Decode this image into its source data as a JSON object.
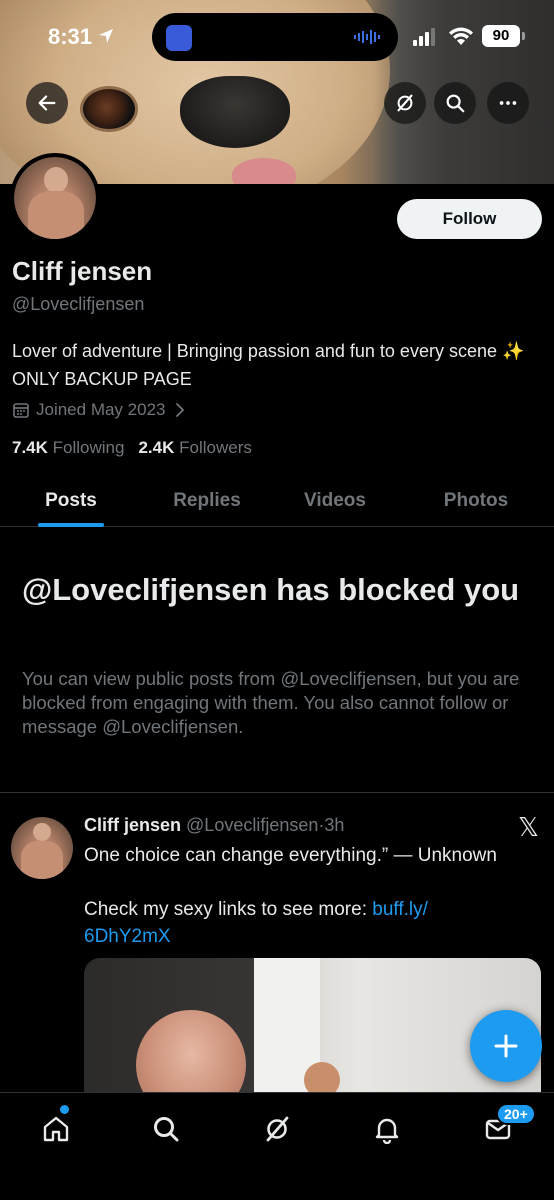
{
  "status_bar": {
    "time": "8:31",
    "battery": "90"
  },
  "header": {
    "back_icon": "arrow-left-icon",
    "grok_icon": "grok-icon",
    "search_icon": "search-icon",
    "more_icon": "more-icon"
  },
  "profile": {
    "follow_label": "Follow",
    "name": "Cliff jensen",
    "handle": "@Loveclifjensen",
    "bio": "Lover of adventure | Bringing passion and fun to every scene ✨ ONLY BACKUP PAGE",
    "joined": "Joined May 2023",
    "following_count": "7.4K",
    "following_label": "Following",
    "followers_count": "2.4K",
    "followers_label": "Followers"
  },
  "tabs": [
    {
      "label": "Posts",
      "active": true
    },
    {
      "label": "Replies",
      "active": false
    },
    {
      "label": "Videos",
      "active": false
    },
    {
      "label": "Photos",
      "active": false
    }
  ],
  "blocked": {
    "title": "@Loveclifjensen has blocked you",
    "description": "You can view public posts from @Loveclifjensen, but you are blocked from engaging with them. You also cannot follow or message @Loveclifjensen."
  },
  "post": {
    "name": "Cliff jensen",
    "handle": "@Loveclifjensen",
    "separator": "·",
    "time": "3h",
    "source_icon": "x-logo-icon",
    "line1": "One choice can change everything.” — Unknown",
    "line2_prefix": "Check my sexy links to see more: ",
    "link_text": "buff.ly/\n6DhY2mX"
  },
  "bottom_nav": {
    "items": [
      "home-icon",
      "search-icon",
      "grok-icon",
      "bell-icon",
      "mail-icon"
    ],
    "messages_badge": "20+"
  },
  "colors": {
    "accent": "#1d9bf0",
    "background": "#000000",
    "secondary_text": "#71767b",
    "primary_text": "#e7e9ea"
  }
}
